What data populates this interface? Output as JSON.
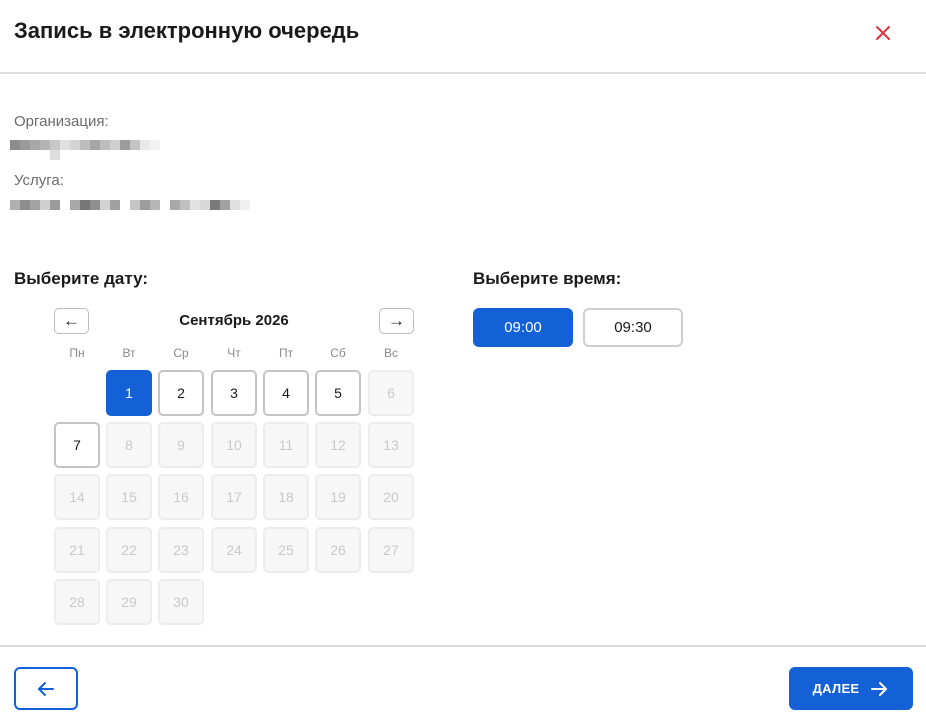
{
  "dialog": {
    "title": "Запись в электронную очередь",
    "close_icon": "close-icon"
  },
  "info": {
    "organization_label": "Организация:",
    "service_label": "Услуга:"
  },
  "date_section": {
    "title": "Выберите дату:",
    "prev_label": "←",
    "next_label": "→",
    "month": "Сентябрь 2026",
    "weekdays": [
      "Пн",
      "Вт",
      "Ср",
      "Чт",
      "Пт",
      "Сб",
      "Вс"
    ],
    "days": [
      {
        "label": "1",
        "state": "selected"
      },
      {
        "label": "2",
        "state": "available"
      },
      {
        "label": "3",
        "state": "available"
      },
      {
        "label": "4",
        "state": "available"
      },
      {
        "label": "5",
        "state": "available"
      },
      {
        "label": "6",
        "state": "disabled"
      },
      {
        "label": "7",
        "state": "available"
      },
      {
        "label": "8",
        "state": "disabled"
      },
      {
        "label": "9",
        "state": "disabled"
      },
      {
        "label": "10",
        "state": "disabled"
      },
      {
        "label": "11",
        "state": "disabled"
      },
      {
        "label": "12",
        "state": "disabled"
      },
      {
        "label": "13",
        "state": "disabled"
      },
      {
        "label": "14",
        "state": "disabled"
      },
      {
        "label": "15",
        "state": "disabled"
      },
      {
        "label": "16",
        "state": "disabled"
      },
      {
        "label": "17",
        "state": "disabled"
      },
      {
        "label": "18",
        "state": "disabled"
      },
      {
        "label": "19",
        "state": "disabled"
      },
      {
        "label": "20",
        "state": "disabled"
      },
      {
        "label": "21",
        "state": "disabled"
      },
      {
        "label": "22",
        "state": "disabled"
      },
      {
        "label": "23",
        "state": "disabled"
      },
      {
        "label": "24",
        "state": "disabled"
      },
      {
        "label": "25",
        "state": "disabled"
      },
      {
        "label": "26",
        "state": "disabled"
      },
      {
        "label": "27",
        "state": "disabled"
      },
      {
        "label": "28",
        "state": "disabled"
      },
      {
        "label": "29",
        "state": "disabled"
      },
      {
        "label": "30",
        "state": "disabled"
      }
    ]
  },
  "time_section": {
    "title": "Выберите время:",
    "slots": [
      {
        "label": "09:00",
        "state": "selected"
      },
      {
        "label": "09:30",
        "state": "normal"
      }
    ]
  },
  "footer": {
    "back_icon": "arrow-left-icon",
    "next_label": "ДАЛЕЕ",
    "next_icon": "arrow-right-icon"
  },
  "colors": {
    "accent": "#1460d6",
    "close": "#d9363e"
  }
}
